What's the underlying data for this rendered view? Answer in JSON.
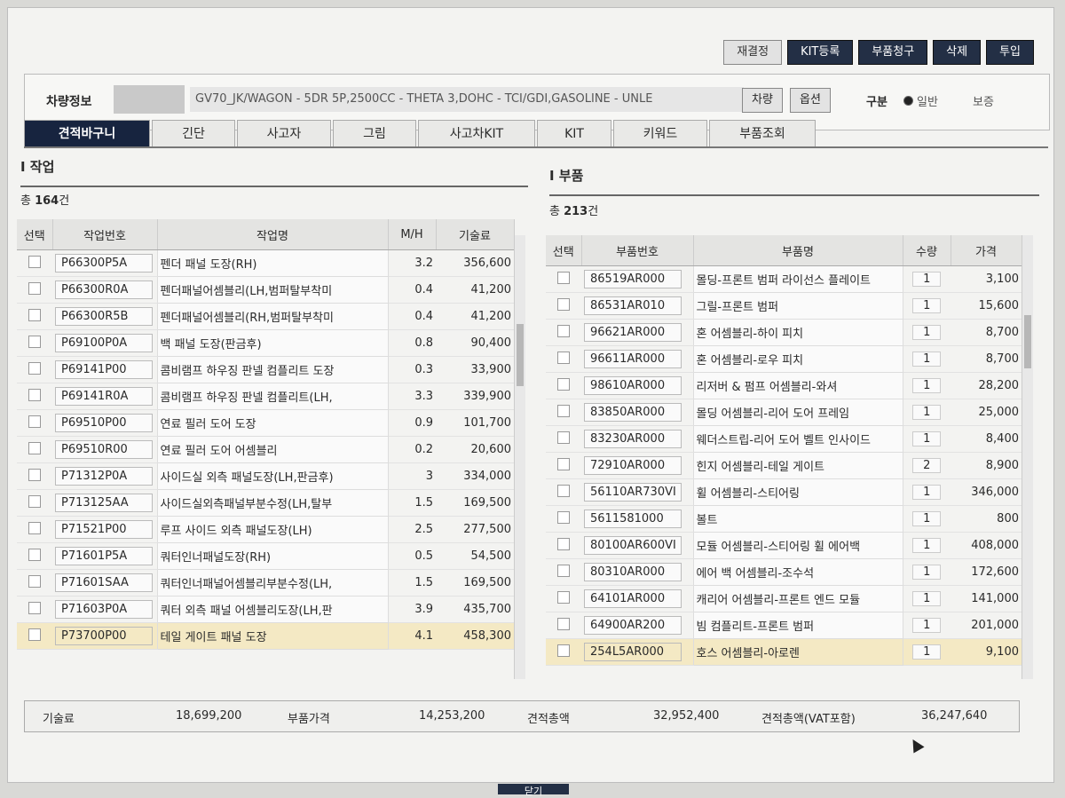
{
  "toolbar": {
    "b1": "재결정",
    "b2": "KIT등록",
    "b3": "부품청구",
    "b4": "삭제",
    "b5": "투입"
  },
  "vehicle": {
    "label": "차량정보",
    "info": "GV70_JK/WAGON - 5DR 5P,2500CC - THETA 3,DOHC - TCI/GDI,GASOLINE - UNLE",
    "btn_car": "차량",
    "btn_option": "옵션",
    "gubun_label": "구분",
    "radio_general": "일반",
    "radio_insurance": "보증"
  },
  "tabs": [
    "견적바구니",
    "긴단",
    "사고자",
    "그림",
    "사고차KIT",
    "KIT",
    "키워드",
    "부품조회"
  ],
  "work": {
    "title": "I 작업",
    "total_prefix": "총 ",
    "total_count": "164",
    "total_suffix": "건",
    "headers": [
      "선택",
      "작업번호",
      "작업명",
      "M/H",
      "기술료"
    ],
    "rows": [
      {
        "code": "P66300P5A",
        "name": "펜더 패널 도장(RH)",
        "mh": "3.2",
        "fee": "356,600"
      },
      {
        "code": "P66300R0A",
        "name": "펜더패널어셈블리(LH,범퍼탈부착미",
        "mh": "0.4",
        "fee": "41,200"
      },
      {
        "code": "P66300R5B",
        "name": "펜더패널어셈블리(RH,범퍼탈부착미",
        "mh": "0.4",
        "fee": "41,200"
      },
      {
        "code": "P69100P0A",
        "name": "백 패널 도장(판금후)",
        "mh": "0.8",
        "fee": "90,400"
      },
      {
        "code": "P69141P00",
        "name": "콤비램프 하우징 판넬 컴플리트 도장",
        "mh": "0.3",
        "fee": "33,900"
      },
      {
        "code": "P69141R0A",
        "name": "콤비램프 하우징 판넬 컴플리트(LH,",
        "mh": "3.3",
        "fee": "339,900"
      },
      {
        "code": "P69510P00",
        "name": "연료 필러 도어 도장",
        "mh": "0.9",
        "fee": "101,700"
      },
      {
        "code": "P69510R00",
        "name": "연료 필러 도어 어셈블리",
        "mh": "0.2",
        "fee": "20,600"
      },
      {
        "code": "P71312P0A",
        "name": "사이드실 외측 패널도장(LH,판금후)",
        "mh": "3",
        "fee": "334,000"
      },
      {
        "code": "P713125AA",
        "name": "사이드실외측패널부분수정(LH,탈부",
        "mh": "1.5",
        "fee": "169,500"
      },
      {
        "code": "P71521P00",
        "name": "루프 사이드 외측 패널도장(LH)",
        "mh": "2.5",
        "fee": "277,500"
      },
      {
        "code": "P71601P5A",
        "name": "쿼터인너패널도장(RH)",
        "mh": "0.5",
        "fee": "54,500"
      },
      {
        "code": "P71601SAA",
        "name": "쿼터인너패널어셈블리부분수정(LH,",
        "mh": "1.5",
        "fee": "169,500"
      },
      {
        "code": "P71603P0A",
        "name": "쿼터 외측 패널 어셈블리도장(LH,판",
        "mh": "3.9",
        "fee": "435,700"
      },
      {
        "code": "P73700P00",
        "name": "테일 게이트 패널 도장",
        "mh": "4.1",
        "fee": "458,300",
        "highlight": true
      }
    ]
  },
  "parts": {
    "title": "I 부품",
    "total_prefix": "총 ",
    "total_count": "213",
    "total_suffix": "건",
    "headers": [
      "선택",
      "부품번호",
      "부품명",
      "수량",
      "가격"
    ],
    "rows": [
      {
        "code": "86519AR000",
        "name": "몰딩-프론트 범퍼 라이선스 플레이트",
        "qty": "1",
        "price": "3,100"
      },
      {
        "code": "86531AR010",
        "name": "그릴-프론트 범퍼",
        "qty": "1",
        "price": "15,600"
      },
      {
        "code": "96621AR000",
        "name": "혼 어셈블리-하이 피치",
        "qty": "1",
        "price": "8,700"
      },
      {
        "code": "96611AR000",
        "name": "혼 어셈블리-로우 피치",
        "qty": "1",
        "price": "8,700"
      },
      {
        "code": "98610AR000",
        "name": "리저버 & 펌프 어셈블리-와셔",
        "qty": "1",
        "price": "28,200"
      },
      {
        "code": "83850AR000",
        "name": "몰딩 어셈블리-리어 도어 프레임",
        "qty": "1",
        "price": "25,000"
      },
      {
        "code": "83230AR000",
        "name": "웨더스트립-리어 도어 벨트 인사이드",
        "qty": "1",
        "price": "8,400"
      },
      {
        "code": "72910AR000",
        "name": "힌지 어셈블리-테일 게이트",
        "qty": "2",
        "price": "8,900"
      },
      {
        "code": "56110AR730VI",
        "name": "휠 어셈블리-스티어링",
        "qty": "1",
        "price": "346,000"
      },
      {
        "code": "5611581000",
        "name": "볼트",
        "qty": "1",
        "price": "800"
      },
      {
        "code": "80100AR600VI",
        "name": "모듈 어셈블리-스티어링 휠 에어백",
        "qty": "1",
        "price": "408,000"
      },
      {
        "code": "80310AR000",
        "name": "에어 백 어셈블리-조수석",
        "qty": "1",
        "price": "172,600"
      },
      {
        "code": "64101AR000",
        "name": "캐리어 어셈블리-프론트 엔드 모듈",
        "qty": "1",
        "price": "141,000"
      },
      {
        "code": "64900AR200",
        "name": "빔 컴플리트-프론트 범퍼",
        "qty": "1",
        "price": "201,000"
      },
      {
        "code": "254L5AR000",
        "name": "호스 어셈블리-아로렌",
        "qty": "1",
        "price": "9,100",
        "highlight": true
      }
    ]
  },
  "footer": {
    "tech_label": "기술료",
    "tech_value": "18,699,200",
    "parts_label": "부품가격",
    "parts_value": "14,253,200",
    "est_label": "견적총액",
    "est_value": "32,952,400",
    "vat_label": "견적총액(VAT포함)",
    "vat_value": "36,247,640"
  },
  "close_label": "닫기"
}
